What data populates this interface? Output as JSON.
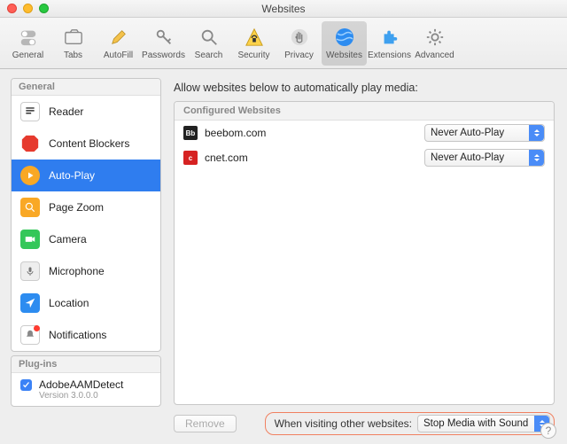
{
  "window": {
    "title": "Websites"
  },
  "toolbar": [
    {
      "label": "General"
    },
    {
      "label": "Tabs"
    },
    {
      "label": "AutoFill"
    },
    {
      "label": "Passwords"
    },
    {
      "label": "Search"
    },
    {
      "label": "Security"
    },
    {
      "label": "Privacy"
    },
    {
      "label": "Websites",
      "selected": true
    },
    {
      "label": "Extensions"
    },
    {
      "label": "Advanced"
    }
  ],
  "sidebar": {
    "general_header": "General",
    "items": [
      {
        "label": "Reader"
      },
      {
        "label": "Content Blockers"
      },
      {
        "label": "Auto-Play"
      },
      {
        "label": "Page Zoom"
      },
      {
        "label": "Camera"
      },
      {
        "label": "Microphone"
      },
      {
        "label": "Location"
      },
      {
        "label": "Notifications"
      }
    ],
    "plugins_header": "Plug-ins",
    "plugin": {
      "name": "AdobeAAMDetect",
      "version": "Version 3.0.0.0"
    }
  },
  "main": {
    "heading": "Allow websites below to automatically play media:",
    "config_header": "Configured Websites",
    "sites": [
      {
        "name": "beebom.com",
        "favtext": "Bb",
        "favbg": "#222222",
        "policy": "Never Auto-Play"
      },
      {
        "name": "cnet.com",
        "favtext": "c",
        "favbg": "#d62222",
        "policy": "Never Auto-Play"
      }
    ],
    "remove_label": "Remove",
    "other_label": "When visiting other websites:",
    "other_policy": "Stop Media with Sound"
  }
}
